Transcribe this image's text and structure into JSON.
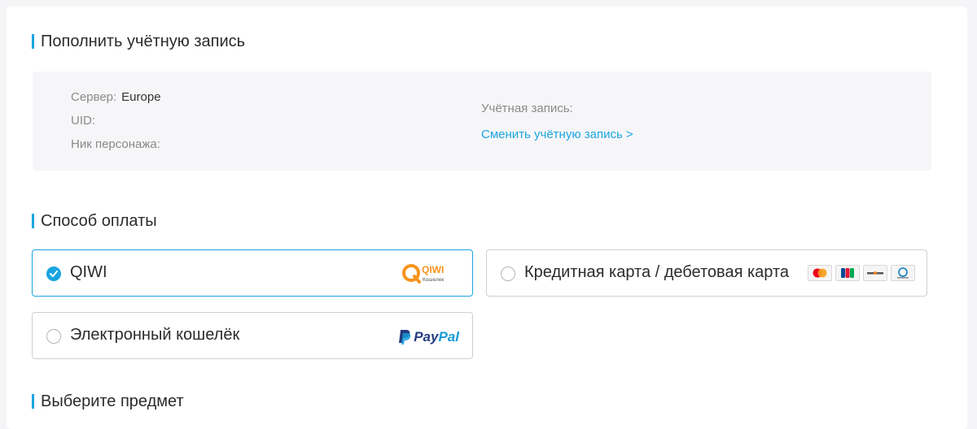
{
  "account_section": {
    "title": "Пополнить учётную запись",
    "server_label": "Сервер:",
    "server_value": "Europe",
    "uid_label": "UID:",
    "nick_label": "Ник персонажа:",
    "account_label": "Учётная запись:",
    "switch_link": "Сменить учётную запись >"
  },
  "payment_section": {
    "title": "Способ оплаты",
    "options": [
      {
        "label": "QIWI",
        "selected": true,
        "logo": "qiwi-logo",
        "logo_text": "QIWI",
        "logo_subtext": "Кошелек"
      },
      {
        "label": "Кредитная карта / дебетовая карта",
        "selected": false,
        "logo": "card-brand-icons",
        "icons": [
          "mastercard-icon",
          "jcb-icon",
          "discover-icon",
          "diners-club-icon"
        ]
      },
      {
        "label": "Электронный кошелёк",
        "selected": false,
        "logo": "paypal-logo",
        "logo_text_1": "Pay",
        "logo_text_2": "Pal"
      }
    ]
  },
  "item_section": {
    "title": "Выберите предмет"
  },
  "colors": {
    "accent": "#1aa5e0",
    "qiwi_orange": "#f7931e",
    "paypal_dark": "#253b80",
    "paypal_light": "#179bd7"
  }
}
